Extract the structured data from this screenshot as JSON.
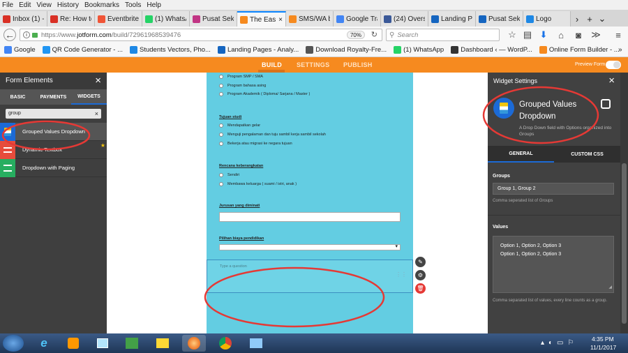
{
  "menubar": {
    "items": [
      "File",
      "Edit",
      "View",
      "History",
      "Bookmarks",
      "Tools",
      "Help"
    ]
  },
  "tabs": [
    {
      "label": "Inbox (1) -",
      "color": "#d93025",
      "icon": "gmail-icon"
    },
    {
      "label": "Re: How to",
      "color": "#d93025",
      "icon": "gmail-icon"
    },
    {
      "label": "Eventbrite",
      "color": "#f05537",
      "icon": "eventbrite-icon"
    },
    {
      "label": "(1) WhatsA",
      "color": "#25d366",
      "icon": "whatsapp-icon"
    },
    {
      "label": "Pusat Seko",
      "color": "#c13584",
      "icon": "instagram-icon"
    },
    {
      "label": "The Eas",
      "color": "#f68a1f",
      "icon": "jotform-icon",
      "active": true,
      "close": "×"
    },
    {
      "label": "SMS/WA b",
      "color": "#f68a1f",
      "icon": "jotform-icon"
    },
    {
      "label": "Google Tra",
      "color": "#4285f4",
      "icon": "google-translate-icon"
    },
    {
      "label": "(24) Overse",
      "color": "#3b5998",
      "icon": "facebook-icon"
    },
    {
      "label": "Landing Pa",
      "color": "#1565c0",
      "icon": "landing-icon"
    },
    {
      "label": "Pusat Seko",
      "color": "#1565c0",
      "icon": "landing-icon"
    },
    {
      "label": "Logo",
      "color": "#1e88e5",
      "icon": "logo-icon"
    }
  ],
  "tab_controls": {
    "scroll_right": "›",
    "new_tab": "+",
    "list": "⌄"
  },
  "navbar": {
    "back": "←",
    "url_prefix": "https://www.",
    "url_domain": "jotform.com",
    "url_path": "/build/72961968539476",
    "zoom": "70%",
    "reload": "↻",
    "search_placeholder": "Search",
    "more": "≫"
  },
  "bookmarks": [
    {
      "label": "Google",
      "color": "#4285f4"
    },
    {
      "label": "QR Code Generator - ...",
      "color": "#2196f3"
    },
    {
      "label": "Students Vectors, Pho...",
      "color": "#1e88e5"
    },
    {
      "label": "Landing Pages - Analy...",
      "color": "#1565c0"
    },
    {
      "label": "Download Royalty-Fre...",
      "color": "#555555"
    },
    {
      "label": "(1) WhatsApp",
      "color": "#25d366"
    },
    {
      "label": "Dashboard ‹ — WordP...",
      "color": "#333333"
    },
    {
      "label": "Online Form Builder - ...",
      "color": "#f68a1f"
    }
  ],
  "bookmarks_more": "»",
  "jotform": {
    "tabs": [
      "BUILD",
      "SETTINGS",
      "PUBLISH"
    ],
    "active_tab": "BUILD",
    "preview_label": "Preview Form"
  },
  "left_panel": {
    "title": "Form Elements",
    "close": "×",
    "tabs": [
      "BASIC",
      "PAYMENTS",
      "WIDGETS"
    ],
    "search_value": "group",
    "search_clear": "×",
    "widgets": [
      {
        "label": "Grouped Values Dropdown",
        "color": "#1c6ad6"
      },
      {
        "label": "Dynamic Textbox",
        "color": "#e74c3c",
        "star": "★"
      },
      {
        "label": "Dropdown with Paging",
        "color": "#27ae60"
      }
    ]
  },
  "form": {
    "options_top": [
      "Program SMP / SMA",
      "Program bahasa asing",
      "Program Akademik ( Diploma/ Sarjana / Master )"
    ],
    "q_tujuan": "Tujuan studi",
    "options_tujuan": [
      "Mendapatkan gelar",
      "Menguji pengalaman dan tuju sambil kerja sambil sekolah",
      "Bekerja atau migrasi ke negara tujuan"
    ],
    "q_rencana": "Rencana keberangkatan",
    "options_rencana": [
      "Sendiri",
      "Membawa keluarga ( suami / istri, anak )"
    ],
    "q_jurusan": "Jurusan yang diminati",
    "q_pilihan": "Pilihan biaya pendidikan",
    "new_question_placeholder": "Type a question"
  },
  "right_panel": {
    "title": "Widget Settings",
    "close": "×",
    "widget_name": "Grouped Values Dropdown",
    "widget_desc": "A Drop Down field with Options organized into Groups",
    "tabs": [
      "GENERAL",
      "CUSTOM CSS"
    ],
    "groups_label": "Groups",
    "groups_value": "Group 1, Group 2",
    "groups_help": "Comma seperated list of Groups",
    "values_label": "Values",
    "values_lines": [
      "Option 1, Option 2, Option 3",
      "Option 1, Option 2, Option 3"
    ],
    "values_help": "Comma separated list of values, every line counts as a group."
  },
  "taskbar": {
    "time": "4:35 PM",
    "date": "11/1/2017"
  },
  "annotations": {
    "color": "#e53935"
  }
}
